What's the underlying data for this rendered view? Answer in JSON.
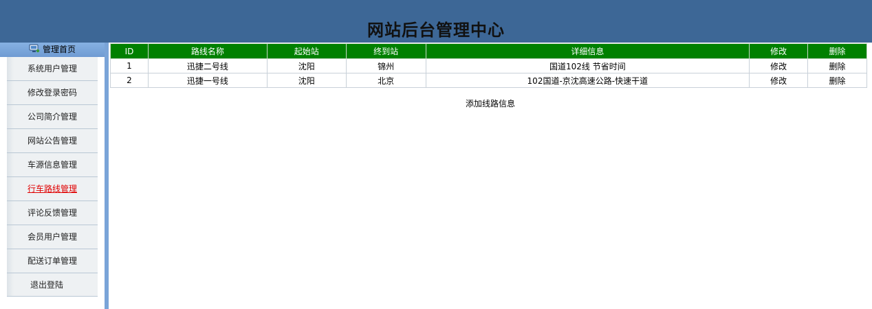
{
  "header": {
    "title": "网站后台管理中心"
  },
  "sidebar": {
    "home_label": "管理首页",
    "items": [
      {
        "label": "系统用户管理"
      },
      {
        "label": "修改登录密码"
      },
      {
        "label": "公司简介管理"
      },
      {
        "label": "网站公告管理"
      },
      {
        "label": "车源信息管理"
      },
      {
        "label": "行车路线管理"
      },
      {
        "label": "评论反馈管理"
      },
      {
        "label": "会员用户管理"
      },
      {
        "label": "配送订单管理"
      },
      {
        "label": "退出登陆"
      }
    ],
    "active_item": "行车路线管理"
  },
  "table": {
    "columns": [
      "ID",
      "路线名称",
      "起始站",
      "终到站",
      "详细信息",
      "修改",
      "删除"
    ],
    "rows": [
      {
        "id": "1",
        "name": "迅捷二号线",
        "start": "沈阳",
        "end": "锦州",
        "detail": "国道102线 节省时间",
        "edit": "修改",
        "delete": "删除"
      },
      {
        "id": "2",
        "name": "迅捷一号线",
        "start": "沈阳",
        "end": "北京",
        "detail": "102国道-京沈高速公路-快速干道",
        "edit": "修改",
        "delete": "删除"
      }
    ]
  },
  "actions": {
    "add_label": "添加线路信息"
  },
  "colors": {
    "header_bg": "#3d6796",
    "table_header_bg": "#008000",
    "active_menu": "#e00000",
    "sidebar_rail": "#7aa4d8"
  }
}
